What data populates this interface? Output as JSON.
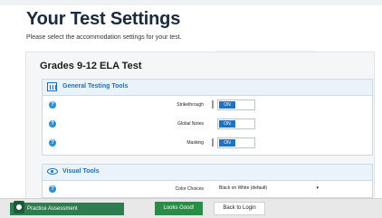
{
  "header": {
    "title": "Your Test Settings",
    "subtitle": "Please select the accommodation settings for your test."
  },
  "test": {
    "name": "Grades 9-12 ELA Test"
  },
  "general_tools": {
    "title": "General Testing Tools",
    "rows": [
      {
        "label": "Strikethrough",
        "value": "ON"
      },
      {
        "label": "Global Notes",
        "value": "ON"
      },
      {
        "label": "Masking",
        "value": "ON"
      }
    ]
  },
  "visual_tools": {
    "title": "Visual Tools",
    "rows": [
      {
        "label": "Color Choices",
        "value": "Black on White (default)"
      }
    ]
  },
  "footer": {
    "practice_label": "Practice Assessment",
    "looks_good_label": "Looks Good!",
    "back_label": "Back to Login"
  },
  "colors": {
    "accent": "#2372c0",
    "section_title": "#1f6eb3",
    "footer_green": "#2a8d47",
    "practice_green": "#2e7d4f"
  },
  "icons": [
    "tools-icon",
    "eye-icon",
    "info-icon",
    "caret-down-icon",
    "practice-logo-icon"
  ]
}
